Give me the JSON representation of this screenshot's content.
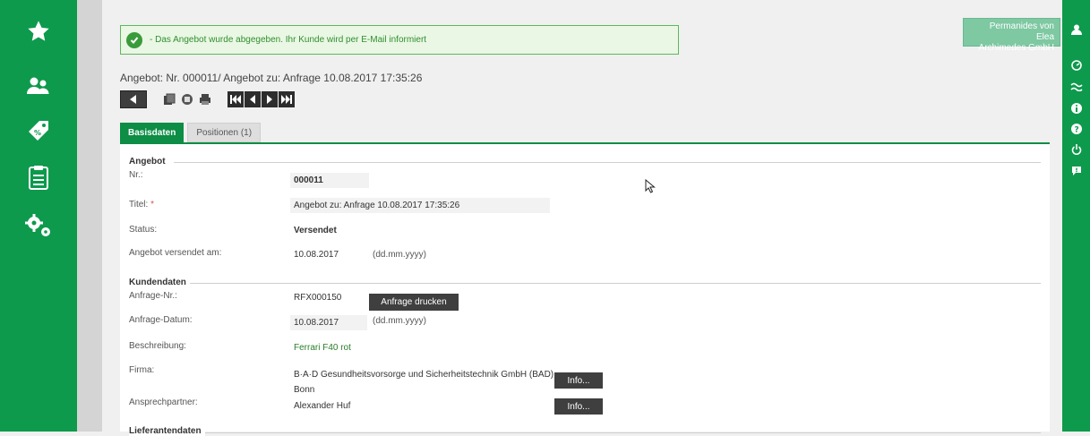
{
  "colors": {
    "brand_green": "#0d9a4c",
    "notice_green": "#2f8f2f",
    "required": "#d9534f"
  },
  "left_nav": [
    {
      "icon": "star-icon"
    },
    {
      "icon": "users-icon"
    },
    {
      "icon": "price-tags-icon"
    },
    {
      "icon": "clipboard-icon"
    },
    {
      "icon": "settings-gears-icon"
    }
  ],
  "right_nav": [
    {
      "icon": "user-icon"
    },
    {
      "icon": "dashboard-icon"
    },
    {
      "icon": "wave-icon"
    },
    {
      "icon": "info-icon"
    },
    {
      "icon": "help-icon"
    },
    {
      "icon": "power-icon"
    },
    {
      "icon": "feedback-icon"
    }
  ],
  "company": {
    "line1": "Permanides von Elea",
    "line2": "Archimedes GmbH"
  },
  "notice": {
    "text": "- Das Angebot wurde abgegeben. Ihr Kunde wird per E-Mail informiert"
  },
  "page_heading": "Angebot: Nr. 000011/ Angebot zu: Anfrage 10.08.2017 17:35:26",
  "tabs": [
    {
      "label": "Basisdaten",
      "active": true
    },
    {
      "label": "Positionen (1)",
      "active": false
    }
  ],
  "angebot": {
    "section": "Angebot",
    "nr_label": "Nr.:",
    "nr_value": "000011",
    "titel_label": "Titel:",
    "titel_required": "*",
    "titel_value": "Angebot zu: Anfrage 10.08.2017 17:35:26",
    "status_label": "Status:",
    "status_value": "Versendet",
    "versendet_label": "Angebot versendet am:",
    "versendet_value": "10.08.2017",
    "versendet_hint": "(dd.mm.yyyy)"
  },
  "kunden": {
    "section": "Kundendaten",
    "anfrage_nr_label": "Anfrage-Nr.:",
    "anfrage_nr_value": "RFX000150",
    "anfrage_drucken": "Anfrage drucken",
    "anfrage_datum_label": "Anfrage-Datum:",
    "anfrage_datum_value": "10.08.2017",
    "anfrage_datum_hint": "(dd.mm.yyyy)",
    "beschreibung_label": "Beschreibung:",
    "beschreibung_value": "Ferrari F40 rot",
    "firma_label": "Firma:",
    "firma_line1": "B·A·D Gesundheitsvorsorge und Sicherheitstechnik GmbH (BAD),",
    "firma_line2": "Bonn",
    "info1": "Info...",
    "ansprechpartner_label": "Ansprechpartner:",
    "ansprechpartner_value": "Alexander Huf",
    "info2": "Info..."
  },
  "lieferanten": {
    "section": "Lieferantendaten"
  }
}
